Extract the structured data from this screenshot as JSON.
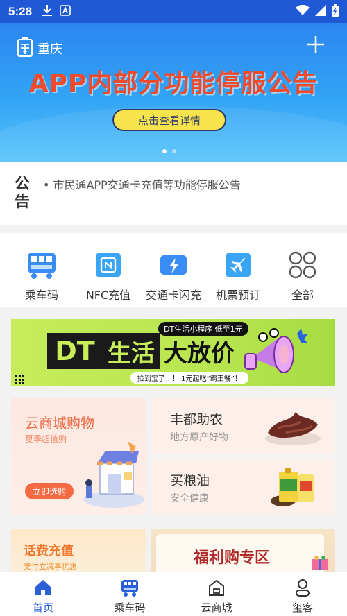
{
  "status_bar": {
    "time": "5:28"
  },
  "banner": {
    "city": "重庆",
    "title": "APP内部分功能停服公告",
    "button_label": "点击查看详情"
  },
  "notice": {
    "icon_text_1": "公",
    "icon_text_2": "告",
    "text": "• 市民通APP交通卡充值等功能停服公告"
  },
  "quick_menu": [
    {
      "label": "乘车码",
      "icon": "bus-qr-icon"
    },
    {
      "label": "NFC充值",
      "icon": "nfc-icon"
    },
    {
      "label": "交通卡闪充",
      "icon": "lightning-card-icon"
    },
    {
      "label": "机票预订",
      "icon": "plane-icon"
    },
    {
      "label": "全部",
      "icon": "grid-icon"
    }
  ],
  "promo": {
    "badge": "DT生活小程序 低至1元",
    "dt": "DT",
    "life": "生活",
    "sale": "大放价",
    "sub": "捡到宝了！！ 1元起吃“霸王餐”！"
  },
  "shop": {
    "big": {
      "title": "云商城购物",
      "subtitle": "夏季超值购",
      "button": "立即选购"
    },
    "card1": {
      "title": "丰都助农",
      "subtitle": "地方原产好物"
    },
    "card2": {
      "title": "买粮油",
      "subtitle": "安全健康"
    }
  },
  "bottom_cards": {
    "fee": {
      "title": "话费充值",
      "subtitle": "支付立减享优惠"
    },
    "welfare": {
      "title": "福利购专区"
    }
  },
  "tabbar": [
    {
      "label": "首页",
      "icon": "home-icon",
      "active": true
    },
    {
      "label": "乘车码",
      "icon": "bus-icon",
      "active": false
    },
    {
      "label": "云商城",
      "icon": "shop-icon",
      "active": false
    },
    {
      "label": "玺客",
      "icon": "user-icon",
      "active": false
    }
  ],
  "colors": {
    "status_bar": "#1f59d6",
    "banner_top": "#2b86f0",
    "banner_title": "#ef4a2c",
    "accent": "#2a5fd8",
    "promo_green": "#c6ec5a"
  }
}
